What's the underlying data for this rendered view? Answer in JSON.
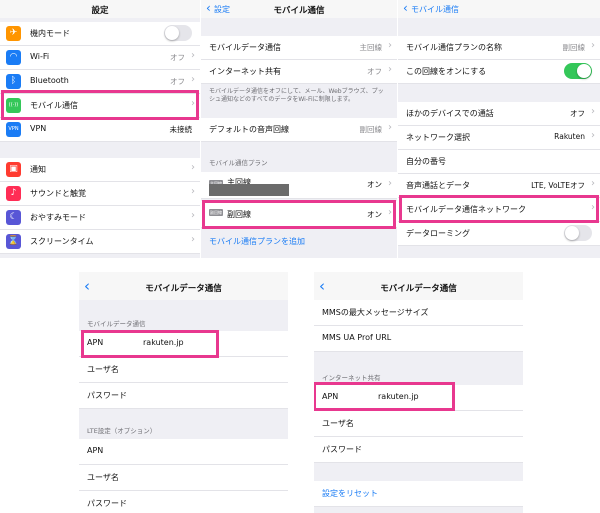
{
  "p1": {
    "title": "設定",
    "rows": [
      {
        "label": "機内モード",
        "value": "",
        "icon": "airplane-icon",
        "glyph": "✈",
        "color": "#ff9500"
      },
      {
        "label": "Wi-Fi",
        "value": "オフ",
        "icon": "wifi-icon",
        "glyph": "◠",
        "color": "#1a7cf5"
      },
      {
        "label": "Bluetooth",
        "value": "オフ",
        "icon": "bluetooth-icon",
        "glyph": "ᛒ",
        "color": "#1a7cf5"
      },
      {
        "label": "モバイル通信",
        "value": "",
        "icon": "antenna-icon",
        "glyph": "((·))",
        "color": "#34c759"
      },
      {
        "label": "VPN",
        "value": "未接続",
        "icon": "vpn-icon",
        "glyph": "VPN",
        "color": "#1a7cf5"
      },
      {
        "label": "通知",
        "value": "",
        "icon": "notification-icon",
        "glyph": "▣",
        "color": "#ff3b30"
      },
      {
        "label": "サウンドと触覚",
        "value": "",
        "icon": "speaker-icon",
        "glyph": "♪",
        "color": "#ff2d55"
      },
      {
        "label": "おやすみモード",
        "value": "",
        "icon": "moon-icon",
        "glyph": "☾",
        "color": "#5856d6"
      },
      {
        "label": "スクリーンタイム",
        "value": "",
        "icon": "hourglass-icon",
        "glyph": "⌛",
        "color": "#5856d6"
      }
    ]
  },
  "p2": {
    "back": "設定",
    "title": "モバイル通信",
    "rows": [
      {
        "label": "モバイルデータ通信",
        "value": "主回線"
      },
      {
        "label": "インターネット共有",
        "value": "オフ"
      }
    ],
    "note": "モバイルデータ通信をオフにして、メール、Webブラウズ、プッシュ通知などのすべてのデータをWi-Fiに制限します。",
    "default_line": {
      "label": "デフォルトの音声回線",
      "value": "副回線"
    },
    "plans_header": "モバイル通信プラン",
    "plans": [
      {
        "sim": "主回線",
        "label": "主回線",
        "value": "オン"
      },
      {
        "sim": "副回線",
        "label": "副回線",
        "value": "オン"
      }
    ],
    "add_plan": "モバイル通信プランを追加"
  },
  "p3": {
    "back": "モバイル通信",
    "rows": [
      {
        "label": "モバイル通信プランの名称",
        "value": "副回線"
      },
      {
        "label": "この回線をオンにする",
        "value": ""
      },
      {
        "label": "ほかのデバイスでの通話",
        "value": "オフ"
      },
      {
        "label": "ネットワーク選択",
        "value": "Rakuten"
      },
      {
        "label": "自分の番号",
        "value": ""
      },
      {
        "label": "音声通話とデータ",
        "value": "LTE, VoLTEオフ"
      },
      {
        "label": "モバイルデータ通信ネットワーク",
        "value": ""
      },
      {
        "label": "データローミング",
        "value": ""
      }
    ]
  },
  "p4": {
    "title": "モバイルデータ通信",
    "section1": "モバイルデータ通信",
    "apn_label": "APN",
    "apn_value": "rakuten.jp",
    "user_label": "ユーザ名",
    "pass_label": "パスワード",
    "section2": "LTE設定（オプション）",
    "lte_apn": "APN",
    "lte_user": "ユーザ名",
    "lte_pass": "パスワード"
  },
  "p5": {
    "title": "モバイルデータ通信",
    "mms_size": "MMSの最大メッセージサイズ",
    "mms_ua": "MMS UA Prof URL",
    "section": "インターネット共有",
    "apn_label": "APN",
    "apn_value": "rakuten.jp",
    "user_label": "ユーザ名",
    "pass_label": "パスワード",
    "reset": "設定をリセット"
  },
  "colors": {
    "highlight": "#e8388f",
    "accent": "#1a7cf5",
    "toggle_on": "#34c759"
  }
}
